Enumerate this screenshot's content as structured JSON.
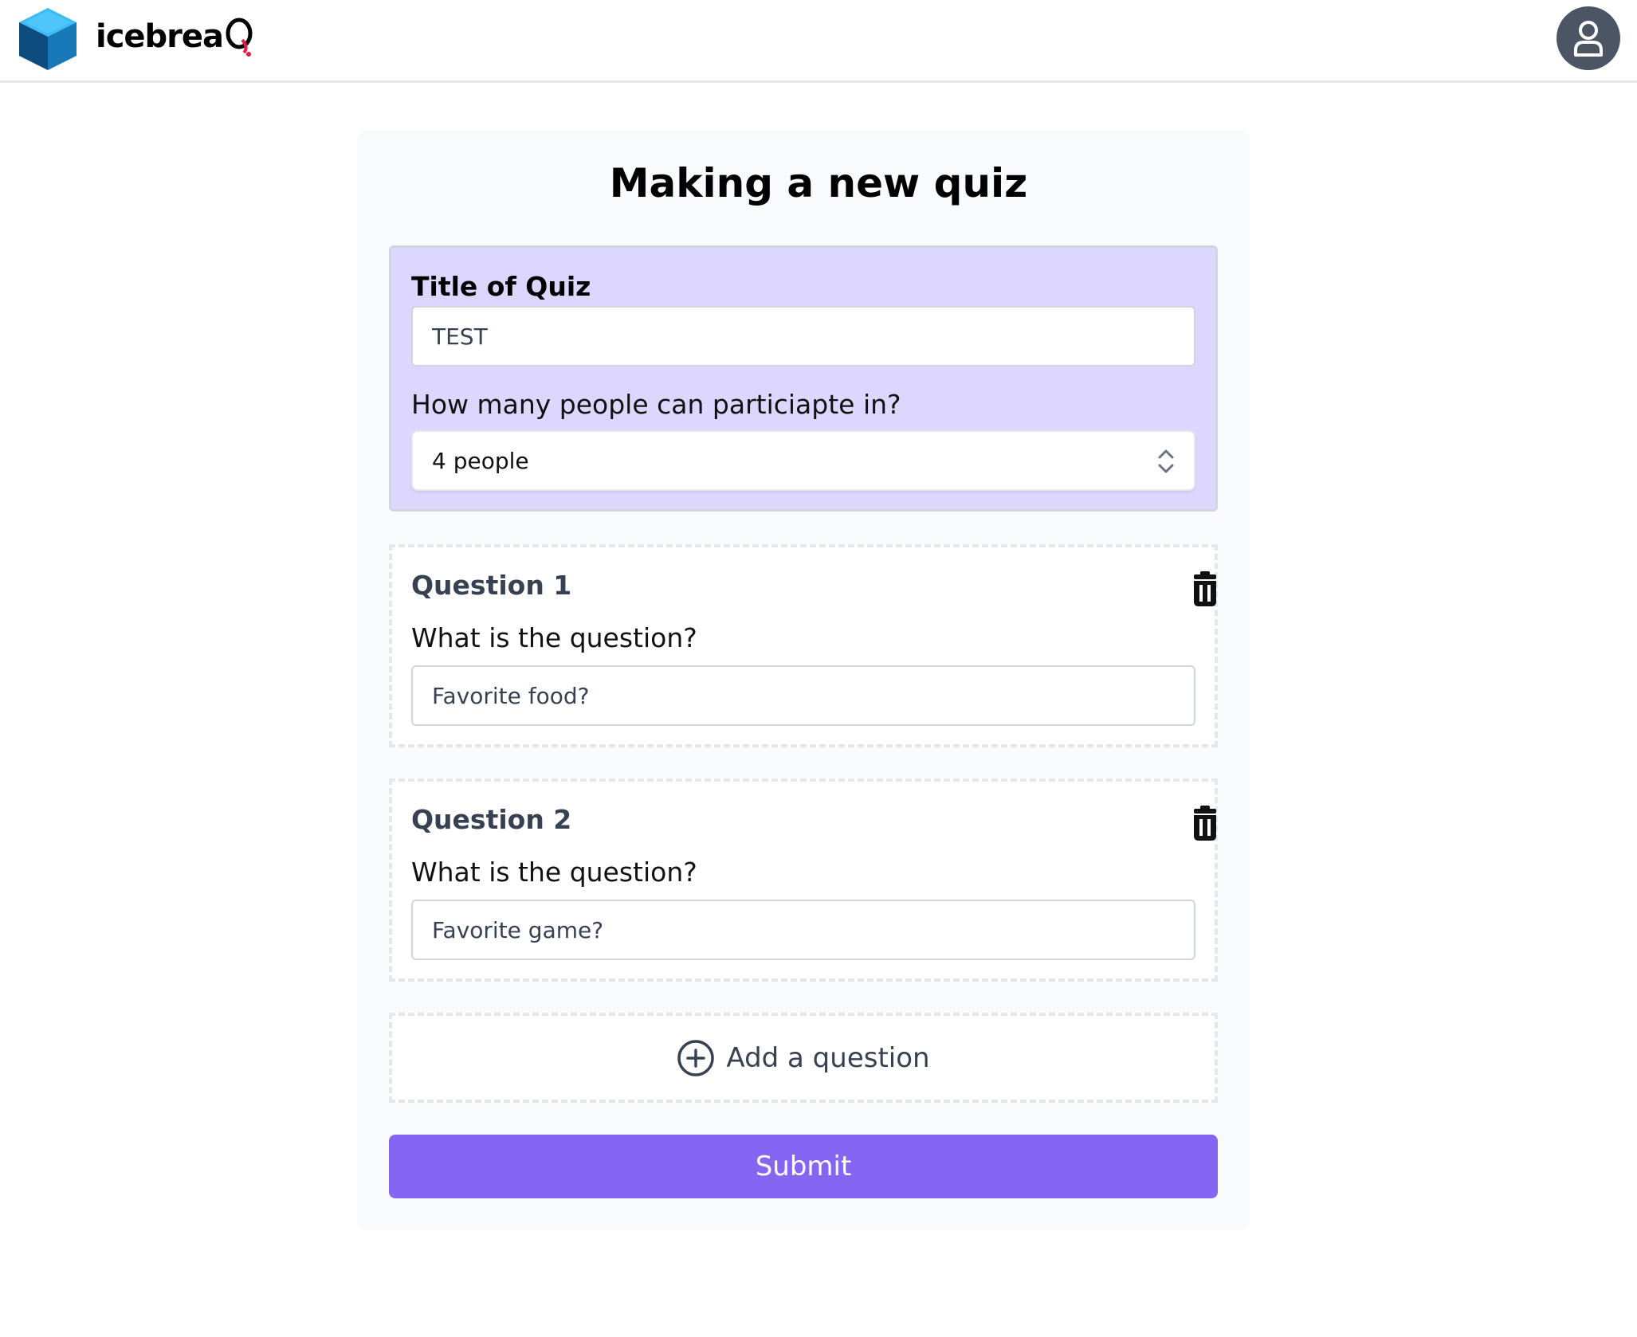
{
  "brand": {
    "name": "icebrea",
    "q_letter": "Q",
    "colors": {
      "cube_top": "#38bdf8",
      "cube_left": "#0e4c7e",
      "cube_right": "#1779b8",
      "q_accent": "#e11d48"
    }
  },
  "header": {
    "avatar_icon": "user-icon"
  },
  "page": {
    "title": "Making a new quiz"
  },
  "settings": {
    "title_label": "Title of Quiz",
    "title_value": "TEST",
    "participants_label": "How many people can particiapte in?",
    "participants_value": "4 people",
    "background": "#ddd6fe"
  },
  "questions": [
    {
      "heading": "Question 1",
      "prompt_label": "What is the question?",
      "value": "Favorite food?",
      "delete_icon": "trash-icon"
    },
    {
      "heading": "Question 2",
      "prompt_label": "What is the question?",
      "value": "Favorite game?",
      "delete_icon": "trash-icon"
    }
  ],
  "add_question": {
    "label": "Add a question",
    "icon": "plus-circle-icon"
  },
  "submit": {
    "label": "Submit",
    "color": "#8466f2"
  }
}
